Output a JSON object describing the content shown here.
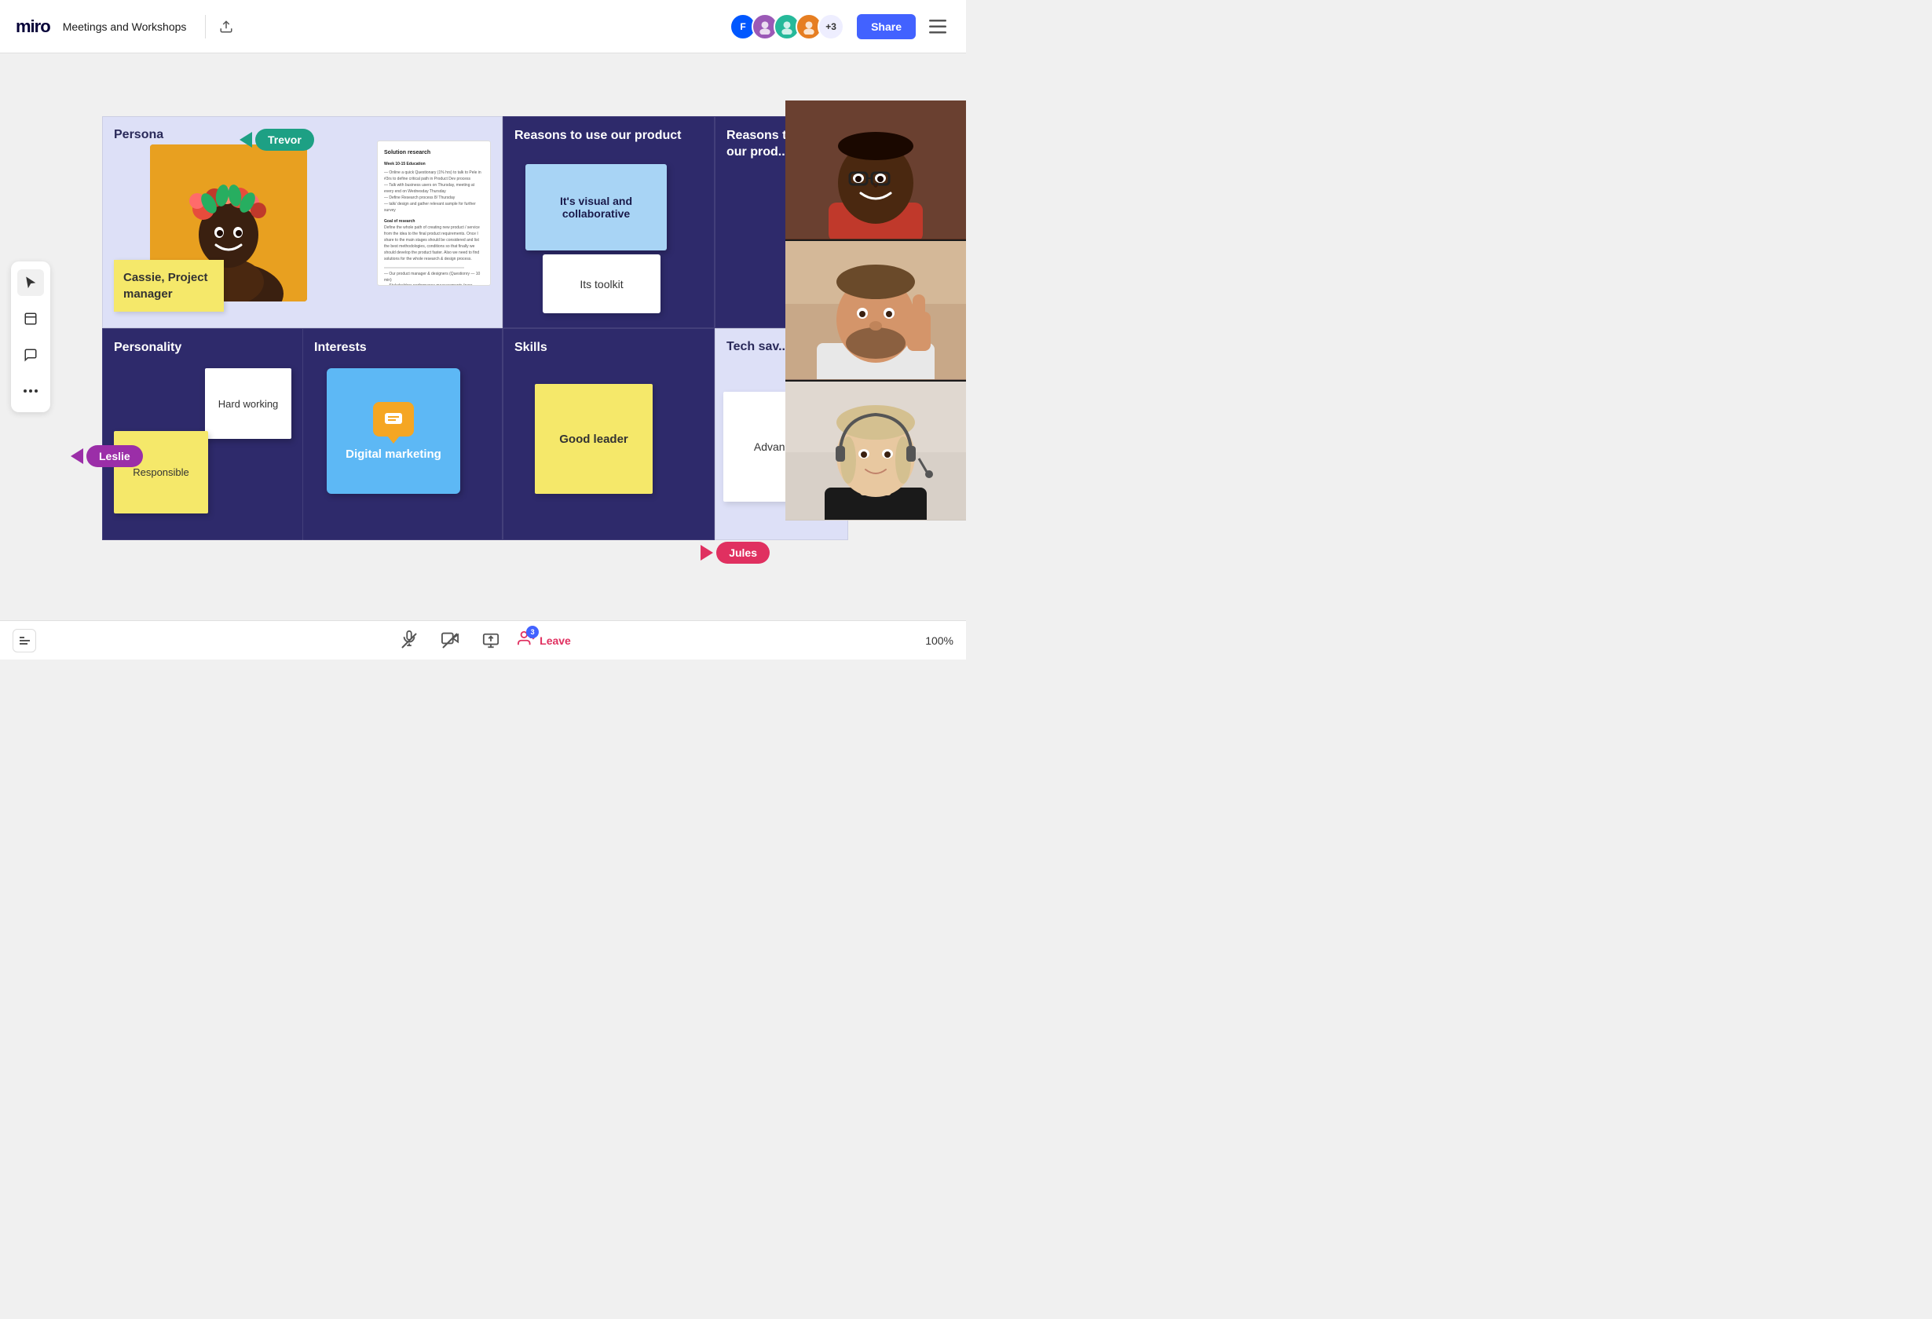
{
  "header": {
    "logo": "miro",
    "board_title": "Meetings and Workshops",
    "share_label": "Share",
    "avatar_count": "+3"
  },
  "cursors": {
    "trevor": {
      "label": "Trevor",
      "color": "#1da084"
    },
    "leslie": {
      "label": "Leslie",
      "color": "#9B2EA8"
    },
    "jules": {
      "label": "Jules",
      "color": "#e03060"
    }
  },
  "board": {
    "persona": {
      "title": "Persona",
      "name_note": "Cassie, Project manager"
    },
    "reasons": {
      "title": "Reasons to use our product",
      "note1": "It's visual and collaborative",
      "note2": "Its toolkit"
    },
    "reasons2": {
      "title": "Reasons to use our prod..."
    },
    "personality": {
      "title": "Personality",
      "note1": "Hard working",
      "note2": "Responsible"
    },
    "interests": {
      "title": "Interests",
      "note1": "Digital marketing"
    },
    "skills": {
      "title": "Skills",
      "note1": "Good leader"
    },
    "techsav": {
      "title": "Tech sav...",
      "note1": "Advanced"
    }
  },
  "bottom_bar": {
    "zoom_level": "100%",
    "leave_label": "Leave",
    "participant_count": "3"
  }
}
